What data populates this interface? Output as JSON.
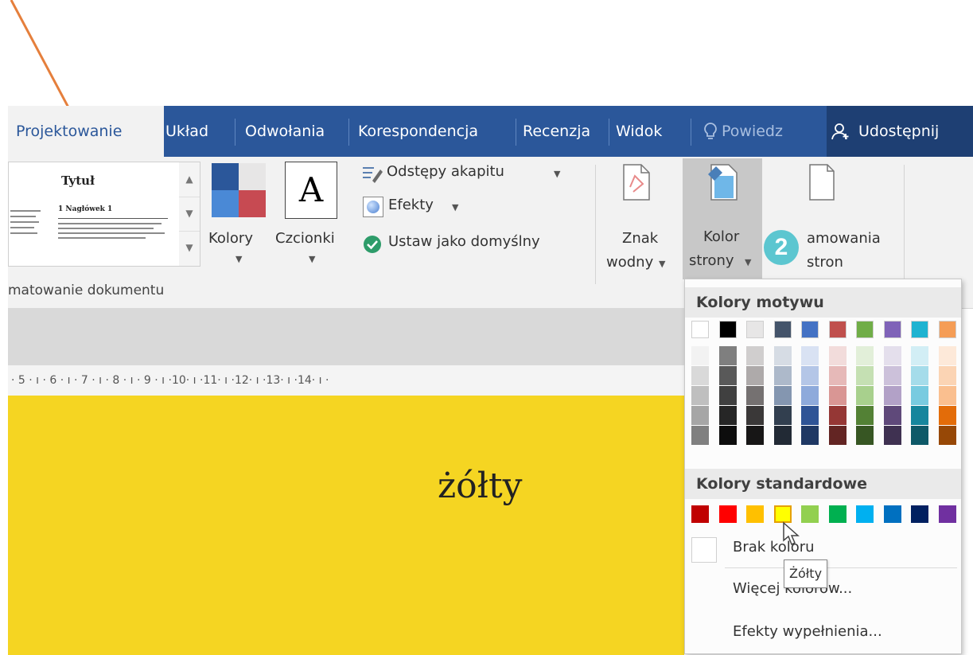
{
  "tabs": [
    {
      "label": "Projektowanie",
      "active": true
    },
    {
      "label": "Układ"
    },
    {
      "label": "Odwołania"
    },
    {
      "label": "Korespondencja"
    },
    {
      "label": "Recenzja"
    },
    {
      "label": "Widok"
    },
    {
      "label": "Powiedz"
    }
  ],
  "share_label": "Udostępnij",
  "gallery": {
    "title": "Tytuł",
    "heading": "1 Nagłówek 1"
  },
  "colors_button": {
    "label": "Kolory"
  },
  "fonts_button": {
    "label": "Czcionki",
    "glyph": "A"
  },
  "spacing_button": {
    "label": "Odstępy akapitu"
  },
  "effects_button": {
    "label": "Efekty"
  },
  "set_default_button": {
    "label": "Ustaw jako domyślny"
  },
  "watermark_button": {
    "line1": "Znak",
    "line2": "wodny"
  },
  "page_color_button": {
    "line1": "Kolor",
    "line2": "strony"
  },
  "page_borders_button": {
    "line1": "amowania",
    "line2": "stron"
  },
  "step_badge": "2",
  "group_label": "matowanie dokumentu",
  "ruler_text": "· 5 · ı · 6 · ı · 7 · ı · 8 · ı · 9 · ı ·10· ı ·11· ı ·12· ı ·13· ı ·14· ı ·",
  "document_text": "żółty",
  "dropdown": {
    "theme_colors_title": "Kolory motywu",
    "standard_colors_title": "Kolory standardowe",
    "no_color_label": "Brak koloru",
    "more_colors_label": "Więcej kolorów...",
    "fill_effects_label": "Efekty wypełnienia...",
    "tooltip": "Żółty"
  },
  "theme_colors": [
    {
      "base": "#ffffff",
      "shades": [
        "#f2f2f2",
        "#d9d9d9",
        "#bfbfbf",
        "#a6a6a6",
        "#808080"
      ]
    },
    {
      "base": "#000000",
      "shades": [
        "#7f7f7f",
        "#595959",
        "#404040",
        "#262626",
        "#0d0d0d"
      ]
    },
    {
      "base": "#e7e6e6",
      "shades": [
        "#d0cece",
        "#aeaaaa",
        "#757171",
        "#3a3838",
        "#171616"
      ]
    },
    {
      "base": "#44546a",
      "shades": [
        "#d6dce4",
        "#adb9ca",
        "#8496b0",
        "#323f4f",
        "#222a35"
      ]
    },
    {
      "base": "#4472c4",
      "shades": [
        "#d9e2f3",
        "#b4c6e7",
        "#8eaadb",
        "#2f5496",
        "#1f3864"
      ]
    },
    {
      "base": "#c0504d",
      "shades": [
        "#f2dcdb",
        "#e6b9b8",
        "#d99694",
        "#953735",
        "#632523"
      ]
    },
    {
      "base": "#70ad47",
      "shades": [
        "#e2efd9",
        "#c5e0b3",
        "#a8d08d",
        "#538135",
        "#375623"
      ]
    },
    {
      "base": "#7f63b8",
      "shades": [
        "#e4dfec",
        "#ccc1da",
        "#b2a1c7",
        "#5f497a",
        "#3f3151"
      ]
    },
    {
      "base": "#1fb3d1",
      "shades": [
        "#d2eef5",
        "#a5dcea",
        "#78cbe0",
        "#16869d",
        "#0e5968"
      ]
    },
    {
      "base": "#f59d56",
      "shades": [
        "#fde9d9",
        "#fbd4b4",
        "#fabf8f",
        "#e36c09",
        "#974806"
      ]
    }
  ],
  "standard_colors": [
    "#c00000",
    "#ff0000",
    "#ffc000",
    "#ffff00",
    "#92d050",
    "#00b050",
    "#00b0f0",
    "#0070c0",
    "#002060",
    "#7030a0"
  ],
  "colors": {
    "tab_bar": "#2b579a",
    "page_fill": "#f5d522",
    "annotation_arrow": "#e57f3c",
    "step_badge": "#5cc6d0"
  }
}
